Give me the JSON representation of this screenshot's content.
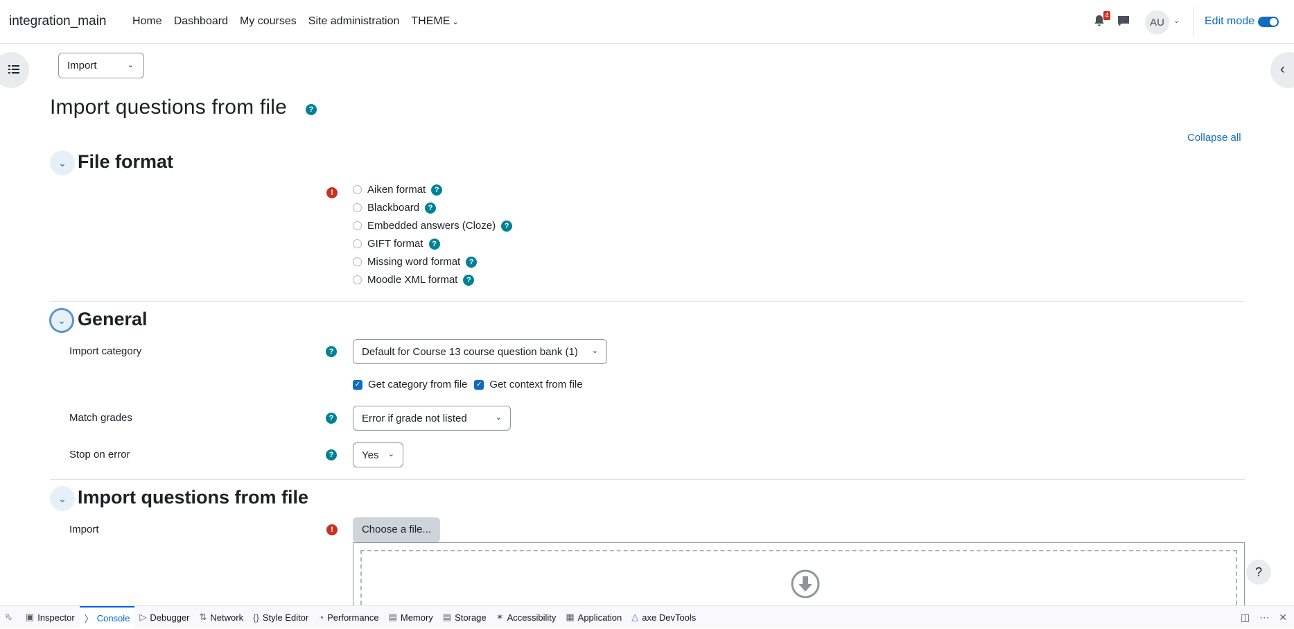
{
  "header": {
    "site_name": "integration_main",
    "nav": [
      "Home",
      "Dashboard",
      "My courses",
      "Site administration",
      "THEME"
    ],
    "notification_count": "4",
    "avatar_initials": "AU",
    "edit_mode_label": "Edit mode",
    "edit_mode_on": true
  },
  "tertiary_select": {
    "value": "Import"
  },
  "page": {
    "title": "Import questions from file",
    "collapse_all": "Collapse all"
  },
  "sections": {
    "file_format": {
      "title": "File format",
      "options": [
        "Aiken format",
        "Blackboard",
        "Embedded answers (Cloze)",
        "GIFT format",
        "Missing word format",
        "Moodle XML format"
      ]
    },
    "general": {
      "title": "General",
      "import_category_label": "Import category",
      "import_category_value": "Default for Course 13 course question bank (1)",
      "get_category_label": "Get category from file",
      "get_context_label": "Get context from file",
      "match_grades_label": "Match grades",
      "match_grades_value": "Error if grade not listed",
      "stop_on_error_label": "Stop on error",
      "stop_on_error_value": "Yes"
    },
    "import_file": {
      "title": "Import questions from file",
      "import_label": "Import",
      "choose_file": "Choose a file..."
    }
  },
  "devtools": {
    "tabs": [
      "Inspector",
      "Console",
      "Debugger",
      "Network",
      "Style Editor",
      "Performance",
      "Memory",
      "Storage",
      "Accessibility",
      "Application",
      "axe DevTools"
    ],
    "active_tab": "Console"
  },
  "colors": {
    "accent": "#0f6cbf",
    "help": "#008196",
    "required": "#ca3120"
  }
}
